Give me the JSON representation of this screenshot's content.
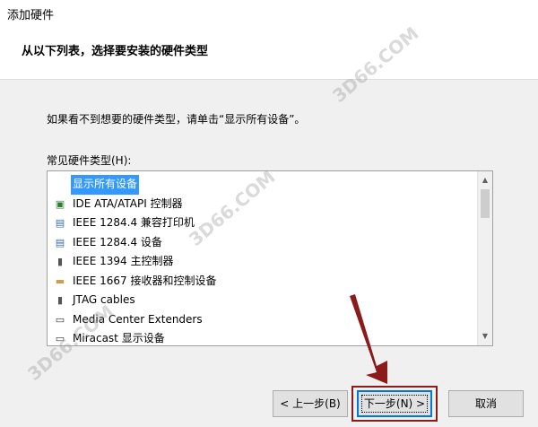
{
  "window": {
    "title": "添加硬件"
  },
  "header": {
    "heading": "从以下列表，选择要安装的硬件类型"
  },
  "instruction": "如果看不到想要的硬件类型，请单击“显示所有设备”。",
  "hardware_list": {
    "label": "常见硬件类型(H):",
    "items": [
      {
        "label": "显示所有设备",
        "icon": "none",
        "selected": true
      },
      {
        "label": "IDE ATA/ATAPI 控制器",
        "icon": "ide-controller-icon",
        "selected": false
      },
      {
        "label": "IEEE 1284.4 兼容打印机",
        "icon": "printer-icon",
        "selected": false
      },
      {
        "label": "IEEE 1284.4 设备",
        "icon": "printer-icon",
        "selected": false
      },
      {
        "label": "IEEE 1394 主控制器",
        "icon": "usb-plug-icon",
        "selected": false
      },
      {
        "label": "IEEE 1667 接收器和控制设备",
        "icon": "usb-drive-icon",
        "selected": false
      },
      {
        "label": "JTAG cables",
        "icon": "usb-plug-icon",
        "selected": false
      },
      {
        "label": "Media Center Extenders",
        "icon": "monitor-icon",
        "selected": false
      },
      {
        "label": "Miracast 显示设备",
        "icon": "monitor-icon",
        "selected": false
      }
    ]
  },
  "buttons": {
    "back": "< 上一步(B)",
    "next": "下一步(N) >",
    "cancel": "取消"
  },
  "watermarks": [
    "3D66.COM",
    "3D66.COM",
    "3D66.COM"
  ],
  "colors": {
    "selection": "#3399ff",
    "focus_border": "#0078d7",
    "annotation": "#8b1a1a"
  }
}
